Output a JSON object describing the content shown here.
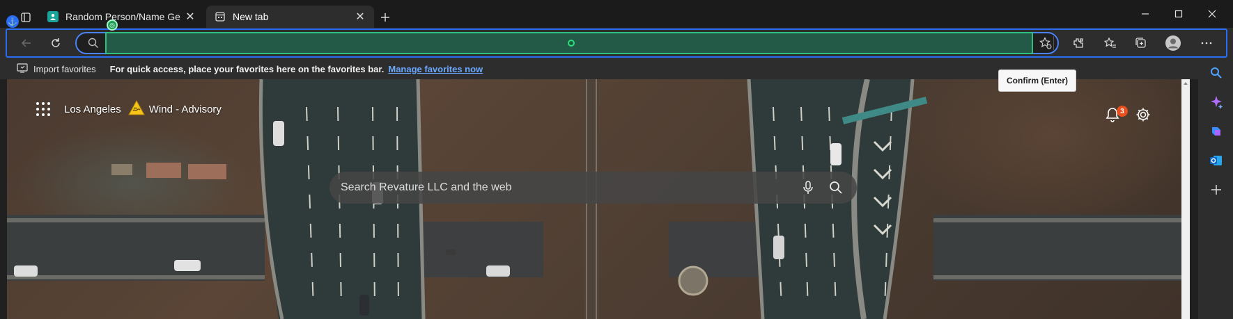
{
  "browser": {
    "tabs": [
      {
        "title": "Random Person/Name Generator",
        "favicon": "person-icon",
        "active": false
      },
      {
        "title": "New tab",
        "favicon": "newtab-icon",
        "active": true
      }
    ],
    "window_controls": [
      "minimize-icon",
      "maximize-icon",
      "close-icon"
    ]
  },
  "toolbar": {
    "address_value": "",
    "tooltip": "Confirm (Enter)"
  },
  "favorites_bar": {
    "import_label": "Import favorites",
    "hint": "For quick access, place your favorites here on the favorites bar.",
    "manage_link": "Manage favorites now"
  },
  "newtab": {
    "location": "Los Angeles",
    "weather_alert": "Wind - Advisory",
    "notification_count": "3",
    "search_placeholder": "Search Revature LLC and the web"
  },
  "colors": {
    "accent": "#2a6df2",
    "badge": "#e8511f",
    "link": "#6aa8ff"
  }
}
